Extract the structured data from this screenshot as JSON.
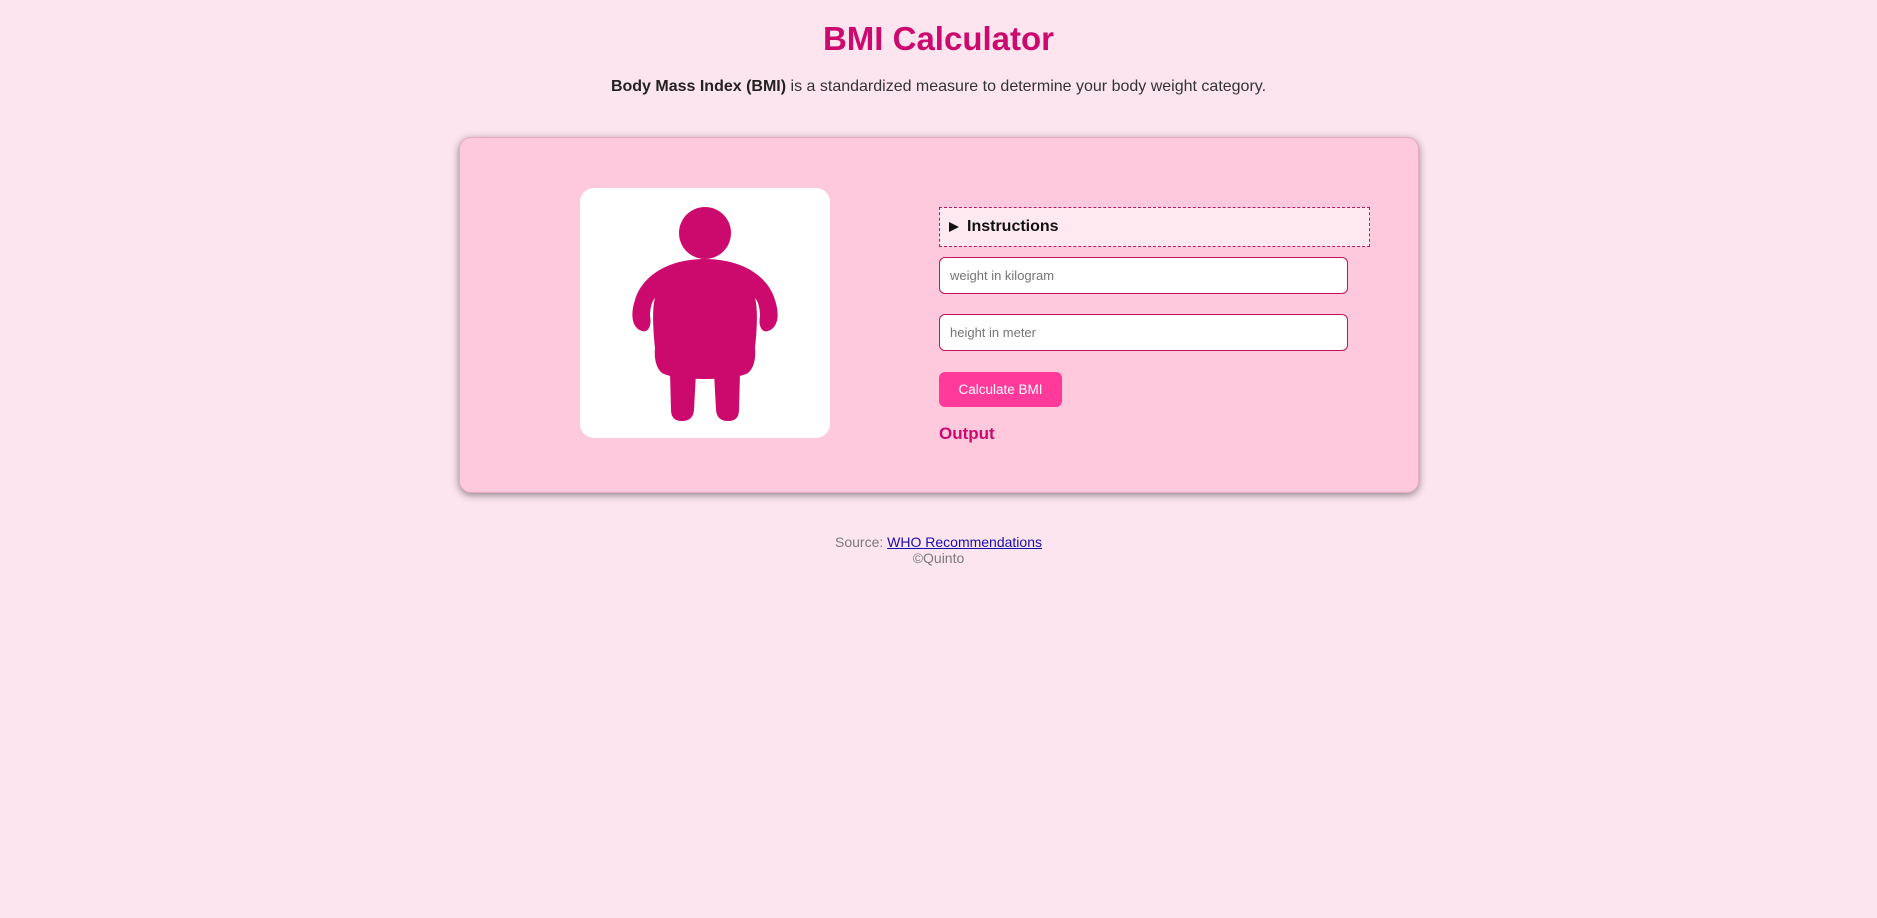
{
  "header": {
    "title": "BMI Calculator",
    "subtitle_bold": "Body Mass Index (BMI)",
    "subtitle_rest": " is a standardized measure to determine your body weight category."
  },
  "calculator": {
    "instructions_label": "Instructions",
    "weight_placeholder": "weight in kilogram",
    "height_placeholder": "height in meter",
    "weight_value": "",
    "height_value": "",
    "calculate_label": "Calculate BMI",
    "output_label": "Output",
    "figure_icon": "obese-person-icon"
  },
  "footer": {
    "source_prefix": "Source: ",
    "source_link": "WHO Recommendations",
    "copyright": "©Quinto"
  },
  "colors": {
    "background": "#fde5ef",
    "accent": "#cc0a6e",
    "card": "#ffc9dd",
    "button": "#ff3a9a"
  }
}
